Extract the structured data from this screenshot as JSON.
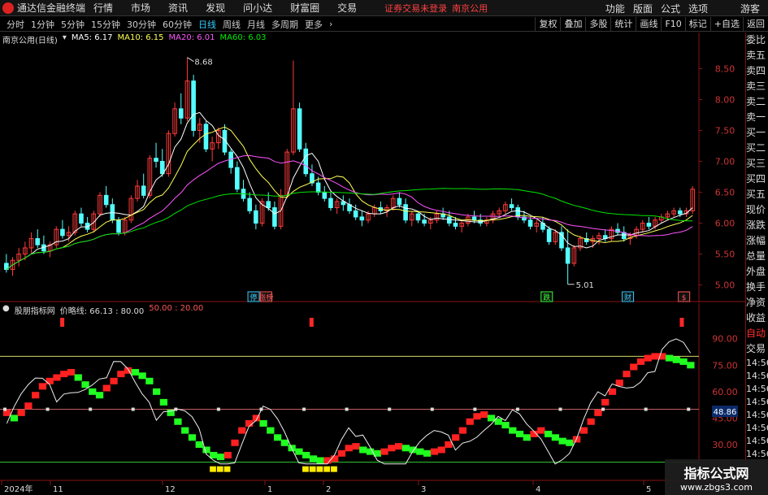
{
  "menubar": {
    "app_title": "通达信金融终端",
    "items": [
      "行情",
      "市场",
      "资讯",
      "发现",
      "问小达",
      "财富圈",
      "交易"
    ],
    "login_status": "证券交易未登录",
    "login_city": "南京公用",
    "right_items": [
      "功能",
      "版面",
      "公式",
      "选项"
    ],
    "guest": "游客"
  },
  "periods": {
    "items": [
      "分时",
      "1分钟",
      "5分钟",
      "15分钟",
      "30分钟",
      "60分钟",
      "日线",
      "周线",
      "月线",
      "多周期",
      "更多"
    ],
    "active": "日线"
  },
  "right_tools": [
    "复权",
    "叠加",
    "多股",
    "统计",
    "画线",
    "F10",
    "标记",
    "+自选",
    "返回"
  ],
  "main_legend": {
    "stock": "南京公用(日线)",
    "ma5": "MA5: 6.17",
    "ma10": "MA10: 6.15",
    "ma20": "MA20: 6.01",
    "ma60": "MA60: 6.03"
  },
  "sub_legend": {
    "name": "股朋指标网",
    "line1": "价略线: 66.13 : 80.00",
    "line2": "50.00 : 20.00"
  },
  "y_axis_main": [
    "8.50",
    "8.00",
    "7.50",
    "7.00",
    "6.50",
    "6.00",
    "5.50",
    "5.00"
  ],
  "y_axis_sub": [
    "90.00",
    "75.00",
    "60.00",
    "45.00",
    "30.00"
  ],
  "sub_current": "48.86",
  "annotations": {
    "high": "8.68",
    "low": "5.01",
    "badges": [
      "停",
      "涨榜",
      "跌",
      "财",
      "$"
    ]
  },
  "x_axis": [
    "2024年",
    "11",
    "12",
    "1",
    "2",
    "3",
    "4",
    "5"
  ],
  "right_panel": [
    "委比",
    "卖五",
    "卖四",
    "卖三",
    "卖二",
    "卖一",
    "买一",
    "买二",
    "买三",
    "买四",
    "买五",
    "现价",
    "涨跌",
    "涨幅",
    "总量",
    "外盘",
    "换手",
    "净资",
    "收益"
  ],
  "right_panel2": [
    "自动",
    "交易"
  ],
  "right_times": [
    "14:56",
    "14:56",
    "14:56",
    "14:56",
    "14:56",
    "14:56",
    "14:56",
    "14:56"
  ],
  "watermark": {
    "line1": "指标公式网",
    "line2": "www.zbgs3.com"
  },
  "colors": {
    "up": "#ff3b3b",
    "down": "#54ffff",
    "ma5": "#ffffff",
    "ma10": "#ffff54",
    "ma20": "#ff54ff",
    "ma60": "#00e600",
    "bull": "#ff2020",
    "bear": "#20ff20"
  },
  "chart_data": [
    {
      "type": "candlestick",
      "title": "南京公用(日线)",
      "ylim": [
        4.85,
        8.9
      ],
      "candles": [
        [
          5.35,
          5.5,
          5.2,
          5.25
        ],
        [
          5.25,
          5.45,
          5.15,
          5.4
        ],
        [
          5.4,
          5.6,
          5.3,
          5.5
        ],
        [
          5.5,
          5.7,
          5.4,
          5.6
        ],
        [
          5.6,
          5.85,
          5.5,
          5.75
        ],
        [
          5.75,
          5.9,
          5.6,
          5.65
        ],
        [
          5.65,
          5.8,
          5.5,
          5.55
        ],
        [
          5.55,
          5.7,
          5.45,
          5.65
        ],
        [
          5.65,
          5.95,
          5.6,
          5.9
        ],
        [
          5.9,
          6.05,
          5.75,
          5.8
        ],
        [
          5.8,
          5.95,
          5.7,
          5.85
        ],
        [
          5.85,
          6.2,
          5.8,
          6.15
        ],
        [
          6.15,
          6.25,
          5.95,
          6.0
        ],
        [
          6.0,
          6.1,
          5.85,
          5.9
        ],
        [
          5.9,
          6.2,
          5.85,
          6.15
        ],
        [
          6.15,
          6.5,
          6.1,
          6.45
        ],
        [
          6.45,
          6.6,
          6.25,
          6.3
        ],
        [
          6.3,
          6.4,
          6.0,
          6.05
        ],
        [
          6.05,
          6.1,
          5.8,
          5.85
        ],
        [
          5.85,
          6.1,
          5.8,
          6.05
        ],
        [
          6.05,
          6.45,
          6.0,
          6.4
        ],
        [
          6.4,
          6.7,
          6.35,
          6.6
        ],
        [
          6.6,
          6.8,
          6.4,
          6.45
        ],
        [
          6.45,
          7.1,
          6.4,
          7.05
        ],
        [
          7.05,
          7.3,
          6.9,
          7.0
        ],
        [
          7.0,
          7.2,
          6.75,
          6.8
        ],
        [
          6.8,
          7.5,
          6.75,
          7.45
        ],
        [
          7.45,
          7.95,
          7.4,
          7.85
        ],
        [
          7.85,
          8.1,
          7.6,
          7.7
        ],
        [
          7.7,
          8.68,
          7.65,
          8.3
        ],
        [
          8.3,
          8.4,
          7.4,
          7.5
        ],
        [
          7.5,
          7.7,
          7.3,
          7.6
        ],
        [
          7.6,
          7.65,
          7.15,
          7.2
        ],
        [
          7.2,
          7.4,
          7.0,
          7.3
        ],
        [
          7.3,
          7.55,
          7.2,
          7.5
        ],
        [
          7.5,
          7.6,
          7.1,
          7.15
        ],
        [
          7.15,
          7.2,
          6.8,
          6.9
        ],
        [
          6.9,
          7.0,
          6.5,
          6.55
        ],
        [
          6.55,
          6.7,
          6.35,
          6.4
        ],
        [
          6.4,
          6.5,
          6.15,
          6.2
        ],
        [
          6.2,
          6.3,
          5.9,
          6.0
        ],
        [
          6.0,
          6.4,
          5.95,
          6.35
        ],
        [
          6.35,
          6.5,
          6.2,
          6.25
        ],
        [
          6.25,
          6.35,
          5.9,
          5.95
        ],
        [
          5.95,
          6.55,
          5.9,
          6.45
        ],
        [
          6.45,
          7.2,
          6.4,
          7.15
        ],
        [
          7.15,
          8.63,
          7.1,
          7.85
        ],
        [
          7.85,
          7.95,
          7.15,
          7.2
        ],
        [
          7.2,
          7.3,
          6.75,
          6.8
        ],
        [
          6.8,
          6.95,
          6.6,
          6.65
        ],
        [
          6.65,
          6.75,
          6.45,
          6.5
        ],
        [
          6.5,
          6.6,
          6.35,
          6.4
        ],
        [
          6.4,
          6.5,
          6.2,
          6.25
        ],
        [
          6.25,
          6.4,
          6.15,
          6.35
        ],
        [
          6.35,
          6.45,
          6.2,
          6.3
        ],
        [
          6.3,
          6.4,
          6.15,
          6.2
        ],
        [
          6.2,
          6.3,
          6.05,
          6.1
        ],
        [
          6.1,
          6.2,
          5.95,
          6.05
        ],
        [
          6.05,
          6.2,
          6.0,
          6.15
        ],
        [
          6.15,
          6.3,
          6.1,
          6.25
        ],
        [
          6.25,
          6.35,
          6.15,
          6.2
        ],
        [
          6.2,
          6.3,
          6.1,
          6.25
        ],
        [
          6.25,
          6.45,
          6.2,
          6.4
        ],
        [
          6.4,
          6.5,
          6.25,
          6.3
        ],
        [
          6.3,
          6.4,
          6.0,
          6.05
        ],
        [
          6.05,
          6.2,
          5.95,
          6.15
        ],
        [
          6.15,
          6.2,
          6.0,
          6.05
        ],
        [
          6.05,
          6.15,
          5.95,
          6.0
        ],
        [
          6.0,
          6.1,
          5.9,
          6.05
        ],
        [
          6.05,
          6.2,
          6.0,
          6.15
        ],
        [
          6.15,
          6.25,
          6.05,
          6.1
        ],
        [
          6.1,
          6.2,
          5.95,
          6.0
        ],
        [
          6.0,
          6.1,
          5.9,
          5.95
        ],
        [
          5.95,
          6.05,
          5.85,
          6.0
        ],
        [
          6.0,
          6.15,
          5.95,
          6.1
        ],
        [
          6.1,
          6.2,
          6.0,
          6.05
        ],
        [
          6.05,
          6.15,
          5.95,
          6.0
        ],
        [
          6.0,
          6.1,
          5.95,
          6.05
        ],
        [
          6.05,
          6.2,
          6.0,
          6.15
        ],
        [
          6.15,
          6.25,
          6.1,
          6.2
        ],
        [
          6.2,
          6.35,
          6.15,
          6.3
        ],
        [
          6.3,
          6.4,
          6.2,
          6.25
        ],
        [
          6.25,
          6.3,
          6.05,
          6.1
        ],
        [
          6.1,
          6.2,
          6.0,
          6.05
        ],
        [
          6.05,
          6.1,
          5.9,
          5.95
        ],
        [
          5.95,
          6.05,
          5.85,
          6.0
        ],
        [
          6.0,
          6.1,
          5.85,
          5.9
        ],
        [
          5.9,
          5.95,
          5.65,
          5.7
        ],
        [
          5.7,
          5.9,
          5.65,
          5.85
        ],
        [
          5.85,
          5.95,
          5.55,
          5.6
        ],
        [
          5.6,
          5.9,
          5.01,
          5.35
        ],
        [
          5.35,
          5.65,
          5.3,
          5.6
        ],
        [
          5.6,
          5.8,
          5.55,
          5.75
        ],
        [
          5.75,
          5.85,
          5.65,
          5.7
        ],
        [
          5.7,
          5.8,
          5.6,
          5.75
        ],
        [
          5.75,
          5.85,
          5.65,
          5.8
        ],
        [
          5.8,
          5.9,
          5.7,
          5.75
        ],
        [
          5.75,
          5.95,
          5.7,
          5.9
        ],
        [
          5.9,
          6.0,
          5.8,
          5.85
        ],
        [
          5.85,
          5.95,
          5.7,
          5.75
        ],
        [
          5.75,
          5.85,
          5.65,
          5.8
        ],
        [
          5.8,
          5.95,
          5.75,
          5.9
        ],
        [
          5.9,
          6.05,
          5.85,
          6.0
        ],
        [
          6.0,
          6.1,
          5.9,
          5.95
        ],
        [
          5.95,
          6.1,
          5.9,
          6.05
        ],
        [
          6.05,
          6.15,
          6.0,
          6.1
        ],
        [
          6.1,
          6.2,
          6.05,
          6.15
        ],
        [
          6.15,
          6.25,
          6.1,
          6.2
        ],
        [
          6.2,
          6.25,
          6.1,
          6.15
        ],
        [
          6.15,
          6.25,
          6.1,
          6.2
        ],
        [
          6.2,
          6.6,
          6.15,
          6.55
        ]
      ],
      "ma": {
        "MA5": 6.17,
        "MA10": 6.15,
        "MA20": 6.01,
        "MA60": 6.03
      }
    },
    {
      "type": "line",
      "title": "股朋指标网",
      "ylim": [
        18,
        100
      ],
      "levels": [
        80,
        50,
        20
      ],
      "series": [
        {
          "name": "价略线",
          "values": [
            48,
            45,
            48,
            52,
            58,
            63,
            66,
            68,
            70,
            71,
            68,
            64,
            60,
            58,
            62,
            66,
            70,
            72,
            71,
            69,
            66,
            60,
            54,
            48,
            43,
            38,
            34,
            30,
            27,
            24,
            23,
            24,
            31,
            38,
            42,
            45,
            42,
            38,
            34,
            31,
            28,
            26,
            24,
            22,
            21,
            21,
            22,
            25,
            28,
            29,
            27,
            26,
            25,
            26,
            28,
            29,
            28,
            27,
            26,
            25,
            26,
            27,
            30,
            34,
            38,
            43,
            46,
            47,
            45,
            43,
            41,
            38,
            36,
            34,
            36,
            38,
            36,
            34,
            32,
            31,
            33,
            38,
            43,
            48,
            54,
            60,
            65,
            70,
            74,
            77,
            79,
            80,
            80,
            79,
            78,
            77,
            75
          ]
        }
      ]
    }
  ]
}
